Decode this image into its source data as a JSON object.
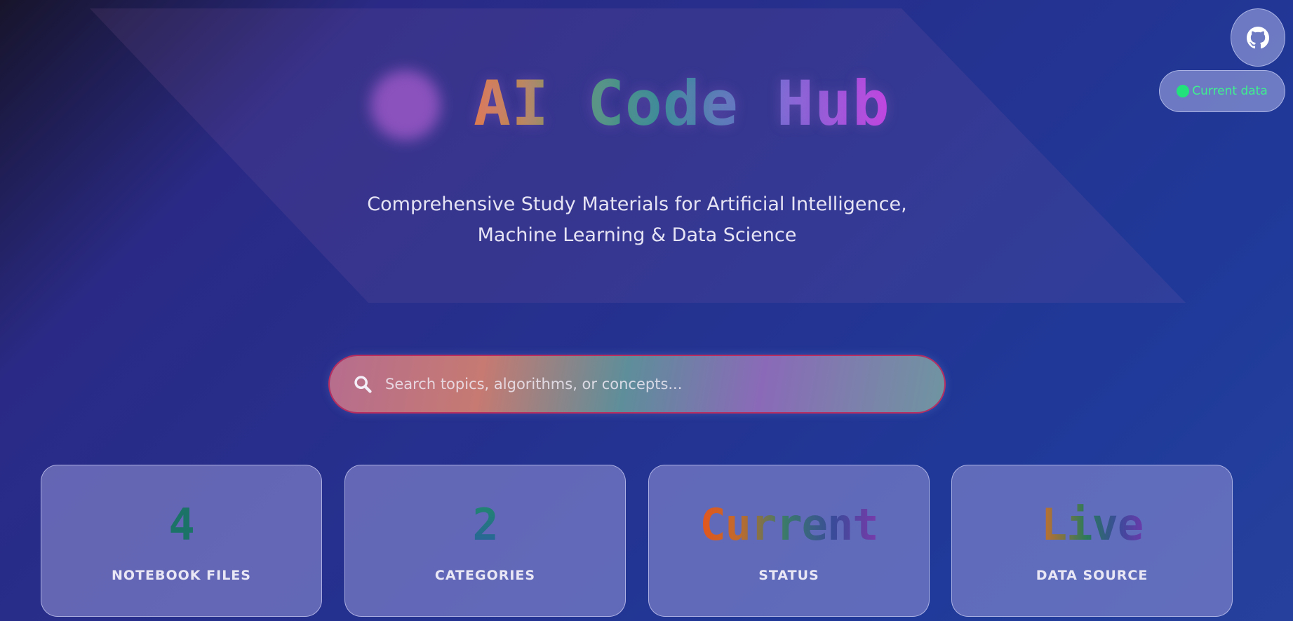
{
  "header": {
    "title": "AI Code Hub",
    "subtitle_line1": "Comprehensive Study Materials for Artificial Intelligence,",
    "subtitle_line2": "Machine Learning & Data Science"
  },
  "top_right": {
    "github_icon": "github-icon",
    "status_label": "Current data",
    "status_color": "#22e37b"
  },
  "search": {
    "placeholder": "Search topics, algorithms, or concepts...",
    "icon": "search-icon"
  },
  "stats": [
    {
      "value": "4",
      "label": "NOTEBOOK FILES"
    },
    {
      "value": "2",
      "label": "CATEGORIES"
    },
    {
      "value": "Current",
      "label": "STATUS"
    },
    {
      "value": "Live",
      "label": "DATA SOURCE"
    }
  ]
}
